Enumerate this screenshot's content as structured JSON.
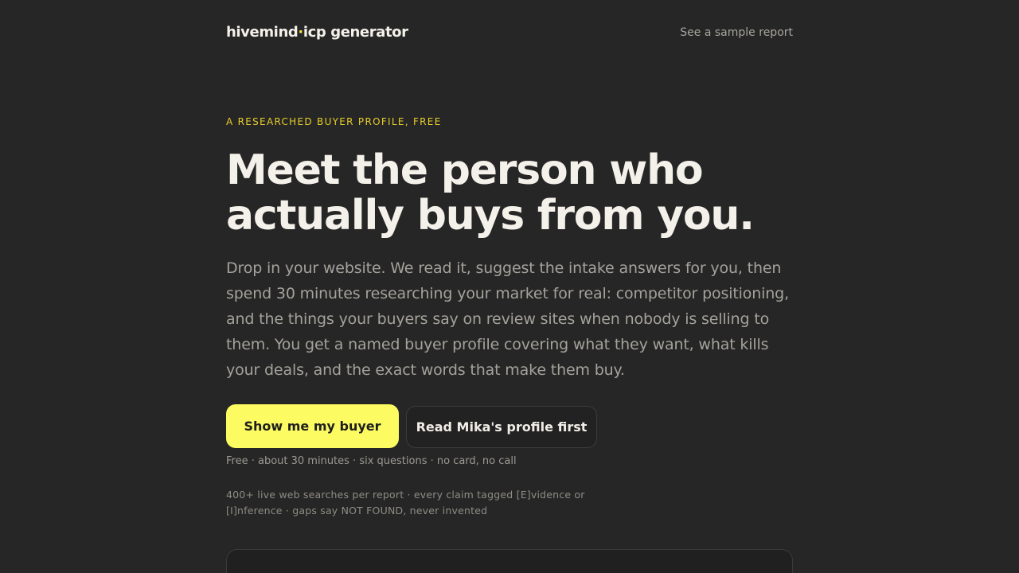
{
  "header": {
    "logo_part1": "hivemind",
    "logo_separator": "·",
    "logo_part2": "icp generator",
    "sample_link": "See a sample report"
  },
  "hero": {
    "eyebrow": "A RESEARCHED BUYER PROFILE, FREE",
    "headline_line1": "Meet the person who",
    "headline_line2": "actually buys from you.",
    "lede": "Drop in your website. We read it, suggest the intake answers for you, then spend 30 minutes researching your market for real: competitor positioning, and the things your buyers say on review sites when nobody is selling to them. You get a named buyer profile covering what they want, what kills your deals, and the exact words that make them buy.",
    "primary_cta": "Show me my buyer",
    "secondary_cta": "Read Mika's profile first",
    "meta_line": "Free · about 30 minutes · six questions · no card, no call",
    "meta_line2": "400+ live web searches per report · every claim tagged [E]vidence or [I]nference · gaps say NOT FOUND, never invented"
  },
  "colors": {
    "background": "#262626",
    "accent": "#fcfc62",
    "eyebrow": "#e8cd2a"
  }
}
